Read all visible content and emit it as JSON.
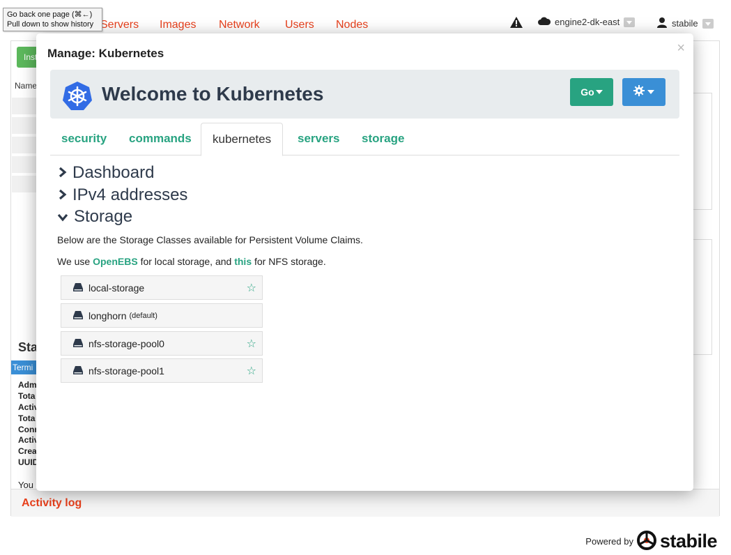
{
  "tooltip": {
    "line1": "Go back one page (⌘←)",
    "line2": "Pull down to show history"
  },
  "nav": {
    "items": [
      "Servers",
      "Images",
      "Network",
      "Users",
      "Nodes"
    ]
  },
  "header_right": {
    "engine": "engine2-dk-east",
    "user": "stabile"
  },
  "background": {
    "install_label": "Inst",
    "name_col": "Name",
    "stats_title": "Sta",
    "terminal_tab": "Termi",
    "labels": [
      "Adm",
      "Tota",
      "Activ",
      "Tota",
      "Conn",
      "Activ",
      "Crea",
      "UUID"
    ],
    "you_text": "You",
    "activity_log": "Activity log",
    "powered_by": "Powered by",
    "brand": "stabile"
  },
  "modal": {
    "title": "Manage: Kubernetes",
    "close": "×",
    "hero_title": "Welcome to Kubernetes",
    "go_label": "Go",
    "tabs": [
      {
        "label": "security",
        "active": false
      },
      {
        "label": "commands",
        "active": false
      },
      {
        "label": "kubernetes",
        "active": true
      },
      {
        "label": "servers",
        "active": false
      },
      {
        "label": "storage",
        "active": false
      }
    ],
    "sections": [
      {
        "label": "Dashboard",
        "expanded": false
      },
      {
        "label": "IPv4 addresses",
        "expanded": false
      },
      {
        "label": "Storage",
        "expanded": true
      }
    ],
    "storage_intro": "Below are the Storage Classes available for Persistent Volume Claims.",
    "storage_note": {
      "pre": "We use ",
      "link1": "OpenEBS",
      "mid": " for local storage, and ",
      "link2": "this",
      "post": " for NFS storage."
    },
    "storage_classes": [
      {
        "name": "local-storage",
        "suffix": "",
        "star": true
      },
      {
        "name": "longhorn",
        "suffix": "(default)",
        "star": false
      },
      {
        "name": "nfs-storage-pool0",
        "suffix": "",
        "star": true
      },
      {
        "name": "nfs-storage-pool1",
        "suffix": "",
        "star": true
      }
    ]
  },
  "colors": {
    "accent_green": "#28a381",
    "nav_red": "#e8401c",
    "gear_blue": "#3a8fd6",
    "kube_blue": "#326ce5"
  }
}
